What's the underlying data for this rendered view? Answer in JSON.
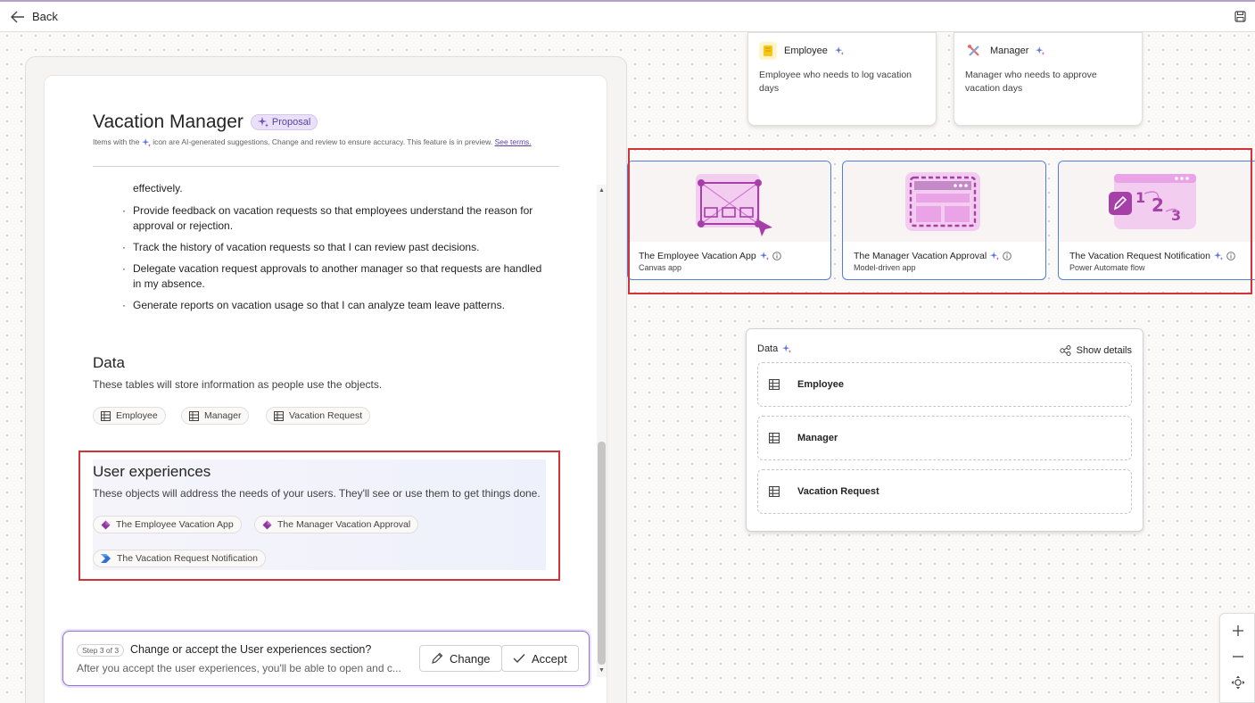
{
  "topbar": {
    "back_label": "Back"
  },
  "doc": {
    "title": "Vacation Manager",
    "badge": "Proposal",
    "ai_note_pre": "Items with the",
    "ai_note_post": "icon are AI-generated suggestions. Change and review to ensure accuracy. This feature is in preview.",
    "see_terms": "See terms."
  },
  "stories": {
    "continued": "effectively.",
    "items": [
      "Provide feedback on vacation requests so that employees understand the reason for approval or rejection.",
      "Track the history of vacation requests so that I can review past decisions.",
      "Delegate vacation request approvals to another manager so that requests are handled in my absence.",
      "Generate reports on vacation usage so that I can analyze team leave patterns."
    ]
  },
  "data_section": {
    "title": "Data",
    "desc": "These tables will store information as people use the objects.",
    "tables": [
      "Employee",
      "Manager",
      "Vacation Request"
    ]
  },
  "ux_section": {
    "title": "User experiences",
    "desc": "These objects will address the needs of your users. They'll see or use them to get things done.",
    "items": [
      "The Employee Vacation App",
      "The Manager Vacation Approval",
      "The Vacation Request Notification"
    ]
  },
  "stepbar": {
    "step": "Step 3 of 3",
    "question": "Change or accept the User experiences section?",
    "sub": "After you accept the user experiences, you'll be able to open and c...",
    "change_label": "Change",
    "accept_label": "Accept"
  },
  "personas": [
    {
      "name": "Employee",
      "desc": "Employee who needs to log vacation days"
    },
    {
      "name": "Manager",
      "desc": "Manager who needs to approve vacation days"
    }
  ],
  "apps": [
    {
      "name": "The Employee Vacation App",
      "type": "Canvas app"
    },
    {
      "name": "The Manager Vacation Approval",
      "type": "Model-driven app"
    },
    {
      "name": "The Vacation Request Notification",
      "type": "Power Automate flow"
    }
  ],
  "data_panel": {
    "title": "Data",
    "show_details": "Show details",
    "rows": [
      "Employee",
      "Manager",
      "Vacation Request"
    ]
  },
  "colors": {
    "accent": "#8f74d3",
    "highlight_red": "#d13438",
    "card_border": "#4f7fd9"
  }
}
